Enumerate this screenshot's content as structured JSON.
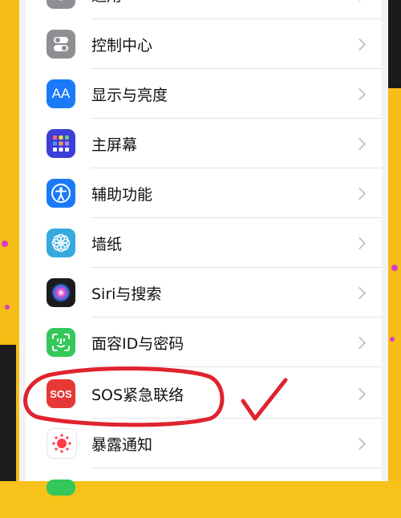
{
  "settings": {
    "items": [
      {
        "label": "通用",
        "icon": "gear-icon",
        "color": "#8e8e93"
      },
      {
        "label": "控制中心",
        "icon": "toggle-icon",
        "color": "#8e8e93"
      },
      {
        "label": "显示与亮度",
        "icon": "text-size-icon",
        "color": "#1a7af8",
        "icon_text": "AA"
      },
      {
        "label": "主屏幕",
        "icon": "home-grid-icon",
        "color": "#3b3fd8"
      },
      {
        "label": "辅助功能",
        "icon": "accessibility-icon",
        "color": "#1a7af8"
      },
      {
        "label": "墙纸",
        "icon": "flower-icon",
        "color": "#36aadf"
      },
      {
        "label": "Siri与搜索",
        "icon": "siri-icon",
        "color": "#1c1c1e"
      },
      {
        "label": "面容ID与密码",
        "icon": "face-id-icon",
        "color": "#34c759"
      },
      {
        "label": "SOS紧急联络",
        "icon": "sos-icon",
        "color": "#e53935",
        "icon_text": "SOS"
      },
      {
        "label": "暴露通知",
        "icon": "exposure-icon",
        "color": "#ffffff"
      }
    ]
  },
  "annotation": {
    "color": "#e0232e",
    "meaning": "circled with checkmark"
  }
}
